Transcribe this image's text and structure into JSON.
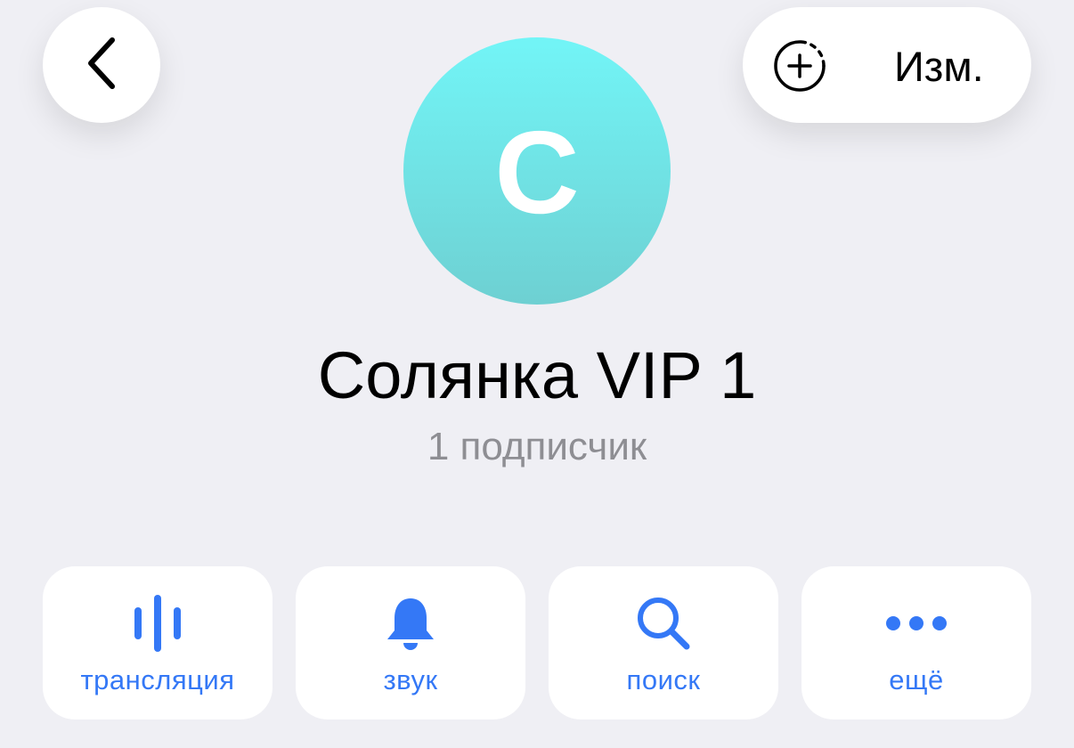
{
  "header": {
    "edit_label": "Изм.",
    "back_icon": "chevron-left-icon",
    "add_icon": "add-circle-dashed-icon"
  },
  "profile": {
    "avatar_letter": "С",
    "avatar_color": "#72f5f7",
    "name": "Солянка VIP 1",
    "subtitle": "1 подписчик"
  },
  "actions": [
    {
      "label": "трансляция",
      "icon": "live-stream-icon"
    },
    {
      "label": "звук",
      "icon": "bell-icon"
    },
    {
      "label": "поиск",
      "icon": "search-icon"
    },
    {
      "label": "ещё",
      "icon": "more-dots-icon"
    }
  ],
  "colors": {
    "accent": "#3478f6",
    "background": "#efeff4",
    "secondary_text": "#8e8e93"
  }
}
